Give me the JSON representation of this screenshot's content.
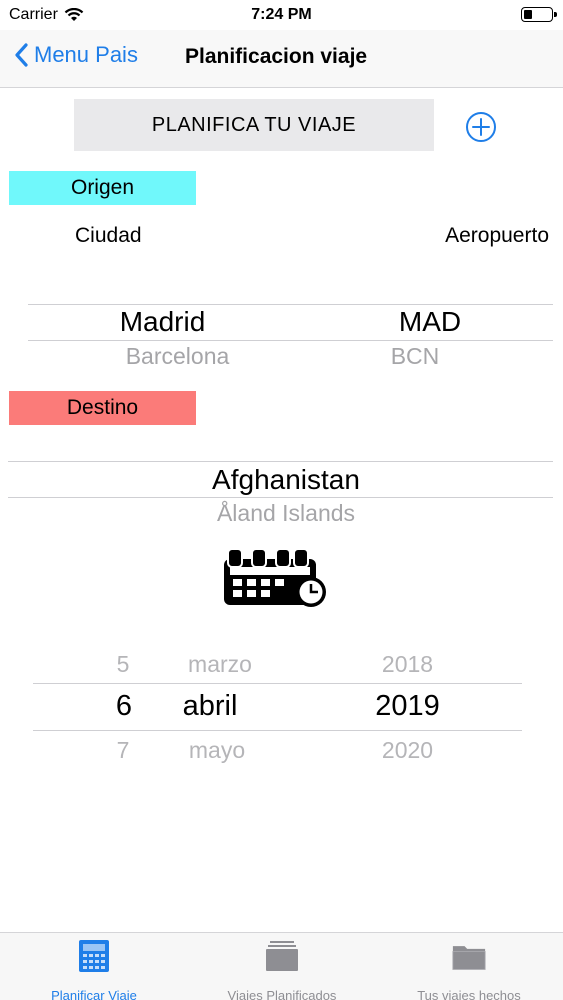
{
  "status_bar": {
    "carrier": "Carrier",
    "time": "7:24 PM"
  },
  "nav": {
    "back_label": "Menu Pais",
    "title": "Planificacion viaje"
  },
  "plan_button_label": "PLANIFICA TU VIAJE",
  "origen": {
    "label": "Origen",
    "city_header": "Ciudad",
    "airport_header": "Aeropuerto",
    "selected_city": "Madrid",
    "selected_airport": "MAD",
    "next_city": "Barcelona",
    "next_airport": "BCN"
  },
  "destino": {
    "label": "Destino",
    "selected_country": "Afghanistan",
    "next_country": "Åland Islands"
  },
  "date_picker": {
    "prev": {
      "day": "5",
      "month": "marzo",
      "year": "2018"
    },
    "selected": {
      "day": "6",
      "month": "abril",
      "year": "2019"
    },
    "next": {
      "day": "7",
      "month": "mayo",
      "year": "2020"
    }
  },
  "tabs": [
    {
      "label": "Planificar Viaje",
      "icon": "calculator-icon"
    },
    {
      "label": "Viajes Planificados",
      "icon": "stack-icon"
    },
    {
      "label": "Tus viajes hechos",
      "icon": "folder-icon"
    }
  ],
  "colors": {
    "accent": "#1f7ee8",
    "origen": "#70f8fb",
    "destino": "#fb7b79"
  }
}
